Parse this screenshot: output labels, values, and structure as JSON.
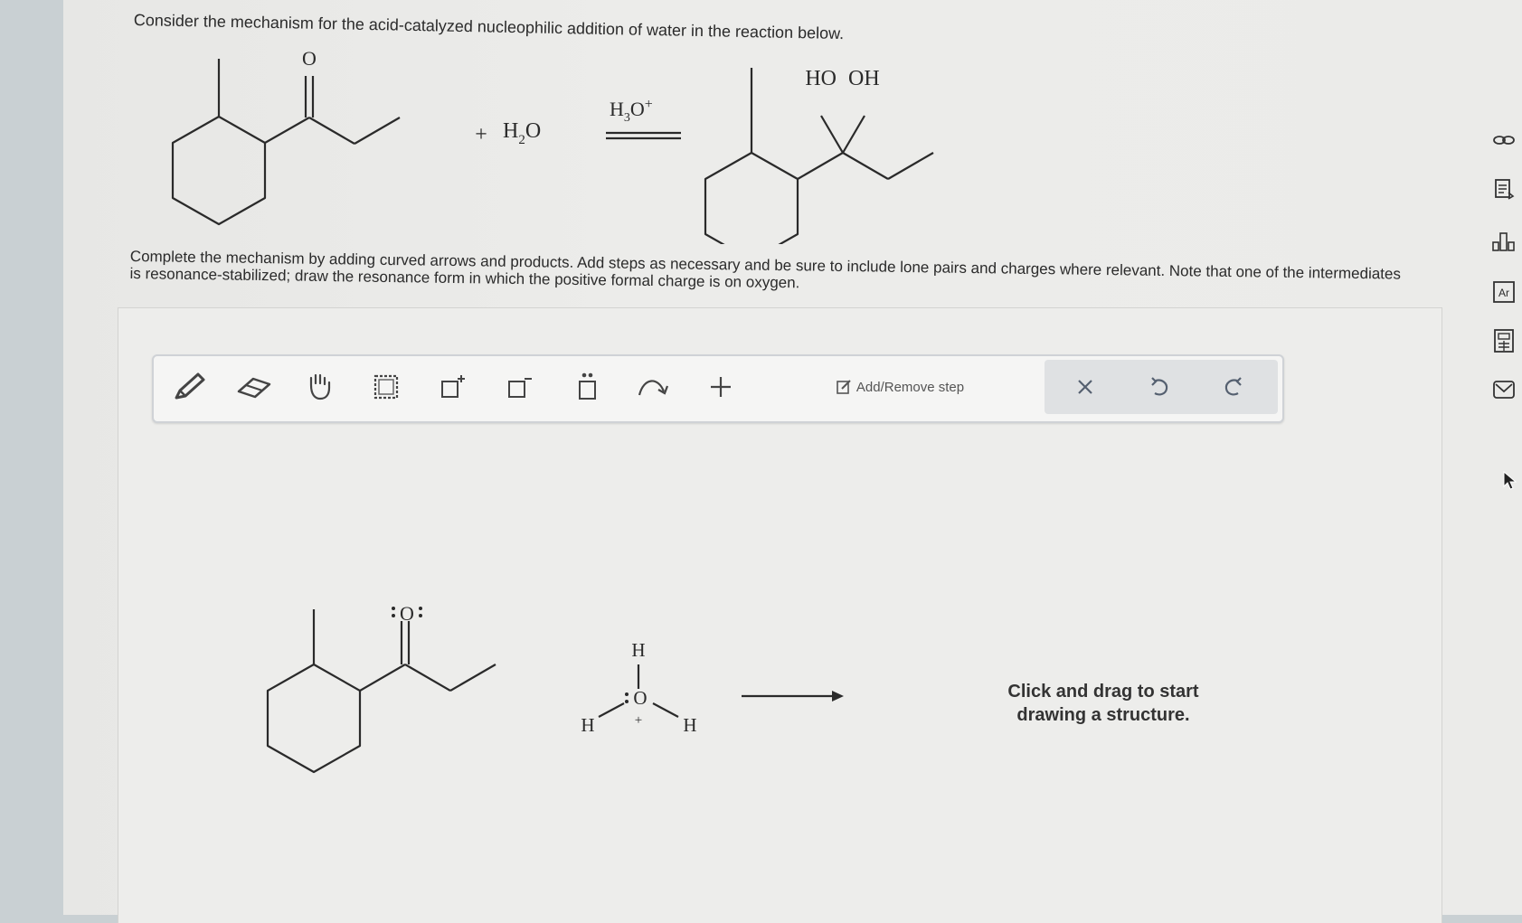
{
  "question": {
    "intro": "Consider the mechanism for the acid-catalyzed nucleophilic addition of water in the reaction below.",
    "instructions": "Complete the mechanism by adding curved arrows and products. Add steps as necessary and be sure to include lone pairs and charges where relevant. Note that one of the intermediates is resonance-stabilized; draw the resonance form in which the positive formal charge is on oxygen."
  },
  "reaction": {
    "ketone_oxygen": "O",
    "plus": "+",
    "water": {
      "H": "H",
      "sub": "2",
      "O": "O"
    },
    "catalyst": {
      "H": "H",
      "sub": "3",
      "O": "O",
      "sup": "+"
    },
    "product_labels": [
      "HO",
      "OH"
    ]
  },
  "toolbar": {
    "tools": [
      {
        "name": "pencil-tool",
        "icon": "pencil-icon"
      },
      {
        "name": "eraser-tool",
        "icon": "eraser-icon"
      },
      {
        "name": "move-tool",
        "icon": "hand-icon"
      },
      {
        "name": "select-tool",
        "icon": "marquee-icon"
      },
      {
        "name": "positive-charge-tool",
        "icon": "positive-charge-icon"
      },
      {
        "name": "negative-charge-tool",
        "icon": "negative-charge-icon"
      },
      {
        "name": "lone-pair-tool",
        "icon": "lone-pair-icon"
      },
      {
        "name": "curved-arrow-tool",
        "icon": "curved-arrow-icon"
      },
      {
        "name": "add-atom-tool",
        "icon": "plus-icon"
      }
    ],
    "add_remove_label": "Add/Remove step",
    "edit_actions": [
      "clear",
      "undo",
      "redo"
    ]
  },
  "canvas": {
    "ketone_oxygen": "O",
    "hydronium": {
      "H_top": "H",
      "O": "O",
      "charge": "+",
      "H_left": "H",
      "H_right": "H"
    },
    "hint_line1": "Click and drag to start",
    "hint_line2": "drawing a structure."
  },
  "sidebar": {
    "icons": [
      "link-icon",
      "notes-icon",
      "periodic-table-icon",
      "element-icon",
      "calculator-icon",
      "mail-icon"
    ],
    "element_label": "Ar"
  },
  "colors": {
    "page": "#ebebe9",
    "toolbar": "#f5f5f4",
    "edit_group": "#dfe1e3",
    "margin": "#c9d0d3"
  }
}
